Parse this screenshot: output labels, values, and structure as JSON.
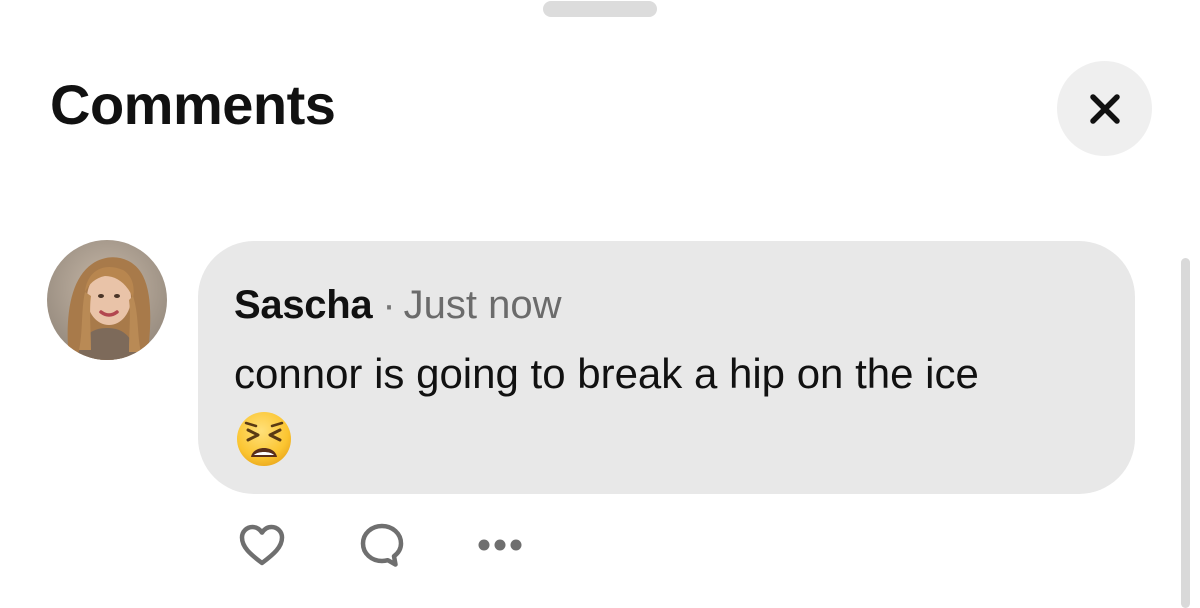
{
  "header": {
    "title": "Comments",
    "close_icon": "close-icon"
  },
  "comments": [
    {
      "author": "Sascha",
      "separator": "·",
      "time": "Just now",
      "text": "connor is going to break a hip on the ice",
      "emoji": "tired-face-emoji",
      "actions": [
        "heart-icon",
        "reply-bubble-icon",
        "more-options-icon"
      ]
    }
  ],
  "colors": {
    "bubble": "#e8e8e8",
    "close_button_bg": "#efefef",
    "secondary_text": "#6b6b6b",
    "icon_gray": "#6f6f6f"
  }
}
